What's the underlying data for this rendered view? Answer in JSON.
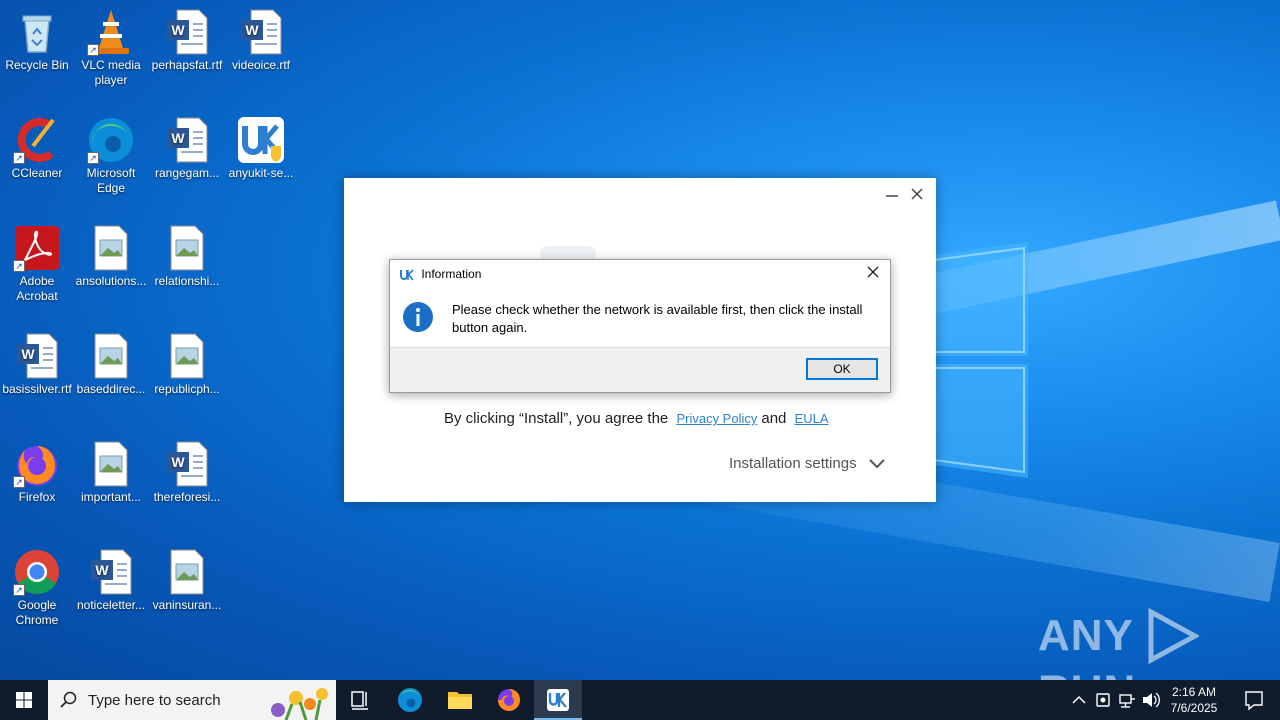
{
  "desktop": {
    "icons": [
      {
        "label": "Recycle Bin"
      },
      {
        "label": "VLC media player"
      },
      {
        "label": "perhapsfat.rtf"
      },
      {
        "label": "videoice.rtf"
      },
      {
        "label": "CCleaner"
      },
      {
        "label": "Microsoft Edge"
      },
      {
        "label": "rangegam..."
      },
      {
        "label": "anyukit-se..."
      },
      {
        "label": "Adobe Acrobat"
      },
      {
        "label": "ansolutions..."
      },
      {
        "label": "relationshi..."
      },
      {
        "label": "basissilver.rtf"
      },
      {
        "label": "baseddirec..."
      },
      {
        "label": "republicph..."
      },
      {
        "label": "Firefox"
      },
      {
        "label": "important..."
      },
      {
        "label": "thereforesi..."
      },
      {
        "label": "Google Chrome"
      },
      {
        "label": "noticeletter..."
      },
      {
        "label": "vaninsuran..."
      }
    ]
  },
  "installer": {
    "agree_text": "By clicking “Install”, you agree the",
    "privacy_link": "Privacy Policy",
    "and_text": "and",
    "eula_link": "EULA",
    "settings_label": "Installation settings"
  },
  "dialog": {
    "title": "Information",
    "message": "Please check whether the network is available first, then click the install button again.",
    "ok_label": "OK"
  },
  "watermark": {
    "left": "ANY",
    "right": "RUN"
  },
  "taskbar": {
    "search_placeholder": "Type here to search",
    "time": "2:16 AM",
    "date": "7/6/2025"
  },
  "colors": {
    "accent": "#0078d7",
    "link": "#2f7fd0",
    "taskbar": "#101c2c"
  }
}
